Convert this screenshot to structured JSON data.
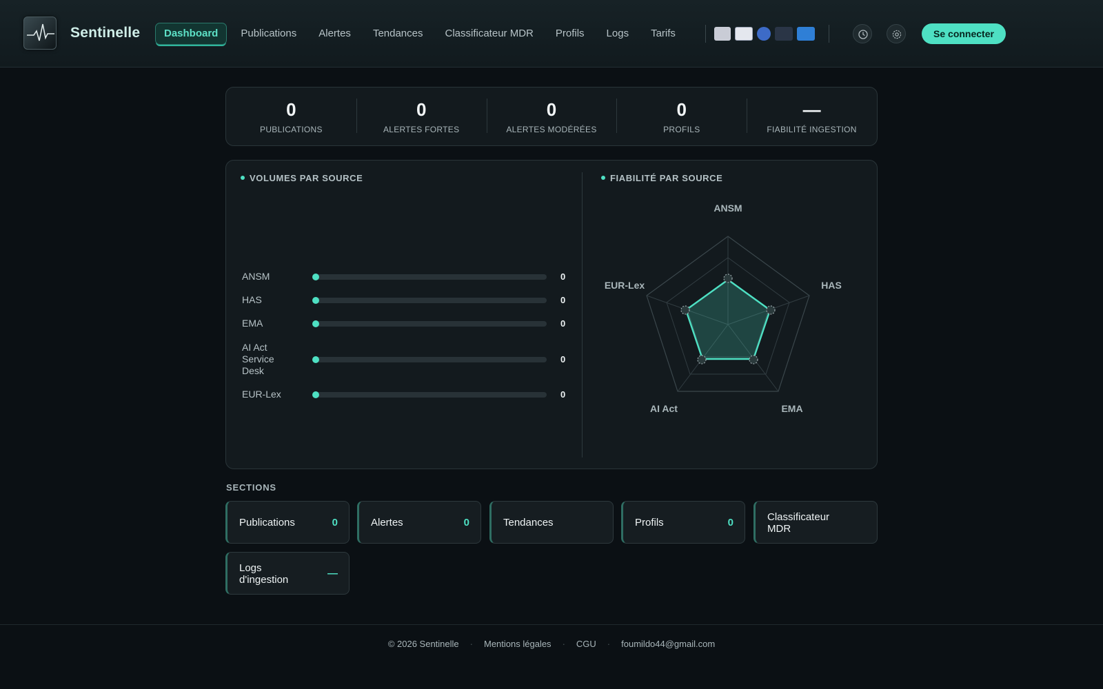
{
  "header": {
    "brand": "Sentinelle",
    "nav": [
      "Dashboard",
      "Publications",
      "Alertes",
      "Tendances",
      "Classificateur MDR",
      "Profils",
      "Logs",
      "Tarifs"
    ],
    "source_logos": [
      "ansm-logo",
      "has-logo",
      "ema-logo",
      "eur-lex-logo",
      "ai-act-logo"
    ],
    "login_label": "Se connecter",
    "accent": "#4ee0c3"
  },
  "stats": [
    {
      "value": "0",
      "label": "PUBLICATIONS"
    },
    {
      "value": "0",
      "label": "ALERTES FORTES"
    },
    {
      "value": "0",
      "label": "ALERTES MODÉRÉES"
    },
    {
      "value": "0",
      "label": "PROFILS"
    },
    {
      "value": "—",
      "label": "FIABILITÉ INGESTION"
    }
  ],
  "volumes": {
    "title": "VOLUMES PAR SOURCE",
    "rows": [
      {
        "label": "ANSM",
        "value": "0"
      },
      {
        "label": "HAS",
        "value": "0"
      },
      {
        "label": "EMA",
        "value": "0"
      },
      {
        "label": "AI Act Service Desk",
        "value": "0"
      },
      {
        "label": "EUR-Lex",
        "value": "0"
      }
    ]
  },
  "reliability": {
    "title": "FIABILITÉ PAR SOURCE",
    "axes": [
      "ANSM",
      "HAS",
      "EMA",
      "AI Act",
      "EUR-Lex"
    ]
  },
  "chart_data": {
    "type": "bar",
    "categories": [
      "ANSM",
      "HAS",
      "EMA",
      "AI Act Service Desk",
      "EUR-Lex"
    ],
    "values": [
      0,
      0,
      0,
      0,
      0
    ],
    "title": "VOLUMES PAR SOURCE"
  },
  "sections": {
    "title": "SECTIONS",
    "items": [
      {
        "label": "Publications",
        "count": "0"
      },
      {
        "label": "Alertes",
        "count": "0"
      },
      {
        "label": "Tendances",
        "count": ""
      },
      {
        "label": "Profils",
        "count": "0"
      },
      {
        "label": "Classificateur MDR",
        "count": ""
      },
      {
        "label": "Logs d'ingestion",
        "count": "—"
      }
    ]
  },
  "footer": {
    "copyright": "© 2026 Sentinelle",
    "legal": "Mentions légales",
    "cgu": "CGU",
    "email": "foumildo44@gmail.com"
  }
}
